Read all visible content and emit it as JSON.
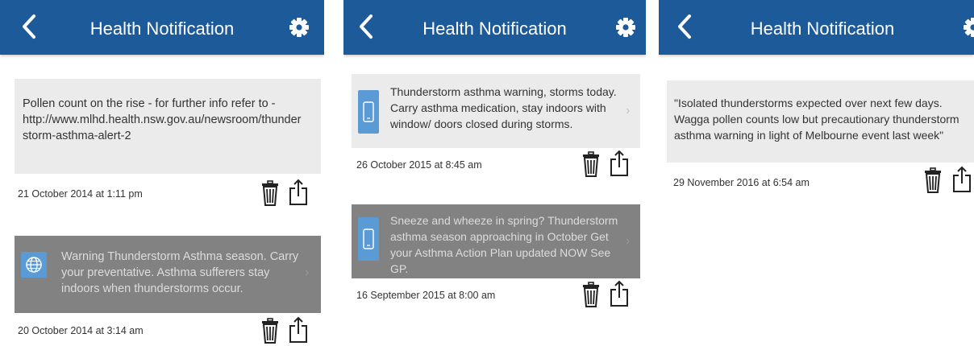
{
  "screens": [
    {
      "header": {
        "title": "Health Notification",
        "back_icon": "chevron-left-icon",
        "settings_icon": "gear-icon"
      },
      "notifications": [
        {
          "message": "Pollen count on the rise - for further info refer to - http://www.mlhd.health.nsw.gov.au/newsroom/thunderstorm-asthma-alert-2",
          "date": "21 October 2014 at 1:11 pm",
          "style": "light"
        },
        {
          "message": "Warning Thunderstorm Asthma season. Carry your preventative. Asthma sufferers stay indoors when thunderstorms occur.",
          "date": "20 October 2014 at 3:14 am",
          "style": "dark",
          "icon": "globe-icon"
        }
      ]
    },
    {
      "header": {
        "title": "Health Notification",
        "back_icon": "chevron-left-icon",
        "settings_icon": "gear-icon"
      },
      "notifications": [
        {
          "message": "Thunderstorm asthma warning, storms today. Carry asthma medication, stay indoors with window/ doors closed during storms.",
          "date": "26 October 2015 at 8:45 am",
          "style": "light",
          "icon": "phone-icon"
        },
        {
          "message": "Sneeze and wheeze in spring? Thunderstorm asthma season approaching in October Get your Asthma Action Plan updated NOW See GP.",
          "date": "16 September 2015 at 8:00 am",
          "style": "dark",
          "icon": "phone-icon"
        }
      ]
    },
    {
      "header": {
        "title": "Health Notification",
        "back_icon": "chevron-left-icon",
        "settings_icon": "gear-icon"
      },
      "notifications": [
        {
          "message": "\"Isolated thunderstorms expected over next few days. Wagga pollen counts low but precautionary thunderstorm asthma warning in light of Melbourne event last week\"",
          "date": "29 November 2016 at 6:54 am",
          "style": "light"
        }
      ]
    }
  ],
  "icons": {
    "delete": "trash-icon",
    "share": "share-icon",
    "open": "chevron-right-icon"
  },
  "colors": {
    "header": "#1d5a9a",
    "card_light": "#ebebeb",
    "card_dark": "#828282",
    "icon_tile": "#5b9bd5"
  }
}
